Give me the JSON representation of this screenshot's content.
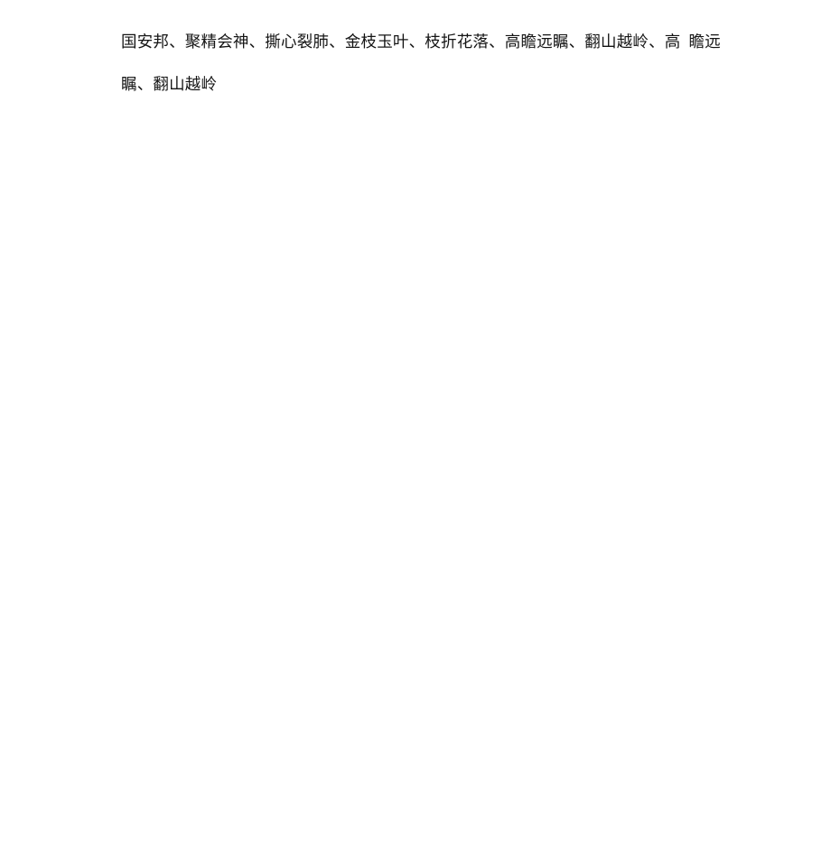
{
  "document": {
    "page_background": "#ffffff",
    "text_color": "#141414",
    "body": {
      "lines": [
        {
          "segment_before_gap": "国安邦、聚精会神、撕心裂肺、金枝玉叶、枝折花落、高瞻远瞩、翻山越岭、高",
          "segment_after_gap": "瞻远",
          "full_text": "国安邦、聚精会神、撕心裂肺、金枝玉叶、枝折花落、高瞻远瞩、翻山越岭、高 瞻远"
        },
        {
          "full_text": "瞩、翻山越岭"
        }
      ],
      "full_paragraph": "国安邦、聚精会神、撕心裂肺、金枝玉叶、枝折花落、高瞻远瞩、翻山越岭、高 瞻远瞩、翻山越岭",
      "phrases": [
        "国安邦",
        "聚精会神",
        "撕心裂肺",
        "金枝玉叶",
        "枝折花落",
        "高瞻远瞩",
        "翻山越岭",
        "高瞻远瞩",
        "翻山越岭"
      ]
    }
  }
}
